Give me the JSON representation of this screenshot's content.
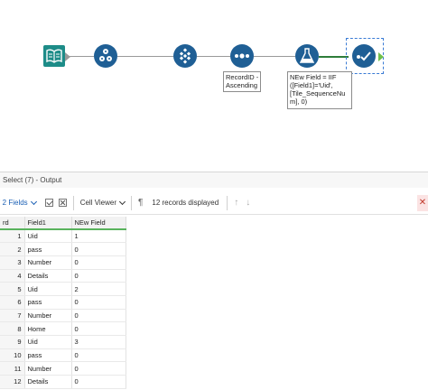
{
  "workflow": {
    "tools": [
      {
        "name": "input-data-tool",
        "icon": "book-icon",
        "color": "#1d8c88"
      },
      {
        "name": "text-to-columns-tool",
        "icon": "numbered-balls-icon",
        "color": "#1f5f95"
      },
      {
        "name": "sample-tool",
        "icon": "diamond-grid-icon",
        "color": "#1f5f95"
      },
      {
        "name": "sort-tool",
        "icon": "dots-icon",
        "color": "#1f5f95"
      },
      {
        "name": "formula-tool",
        "icon": "flask-icon",
        "color": "#1f5f95"
      },
      {
        "name": "select-tool",
        "icon": "checkmark-icon",
        "color": "#1f5f95"
      }
    ],
    "annotations": {
      "sort": "RecordID -\nAscending",
      "formula": "NEw Field = IIF\n([Field1]='Uid',\n[Tile_SequenceNu\nm], 0)"
    }
  },
  "results": {
    "title": "Select (7) - Output",
    "toolbar": {
      "fields_label": "7 2 Fields",
      "viewer_label": "Cell Viewer",
      "records_label": "12 records displayed",
      "close_label": "✕"
    },
    "columns": [
      "rd",
      "Field1",
      "NEw Field"
    ],
    "rows": [
      {
        "n": "1",
        "f1": "Uid",
        "nf": "1"
      },
      {
        "n": "2",
        "f1": "pass",
        "nf": "0"
      },
      {
        "n": "3",
        "f1": "Number",
        "nf": "0"
      },
      {
        "n": "4",
        "f1": "Details",
        "nf": "0"
      },
      {
        "n": "5",
        "f1": "Uid",
        "nf": "2"
      },
      {
        "n": "6",
        "f1": "pass",
        "nf": "0"
      },
      {
        "n": "7",
        "f1": "Number",
        "nf": "0"
      },
      {
        "n": "8",
        "f1": "Home",
        "nf": "0"
      },
      {
        "n": "9",
        "f1": "Uid",
        "nf": "3"
      },
      {
        "n": "10",
        "f1": "pass",
        "nf": "0"
      },
      {
        "n": "11",
        "f1": "Number",
        "nf": "0"
      },
      {
        "n": "12",
        "f1": "Details",
        "nf": "0"
      }
    ]
  },
  "colors": {
    "accent": "#1a5fb4",
    "tool_blue": "#1f5f95",
    "tool_teal": "#1d8c88",
    "header_underline": "#59b35d"
  }
}
